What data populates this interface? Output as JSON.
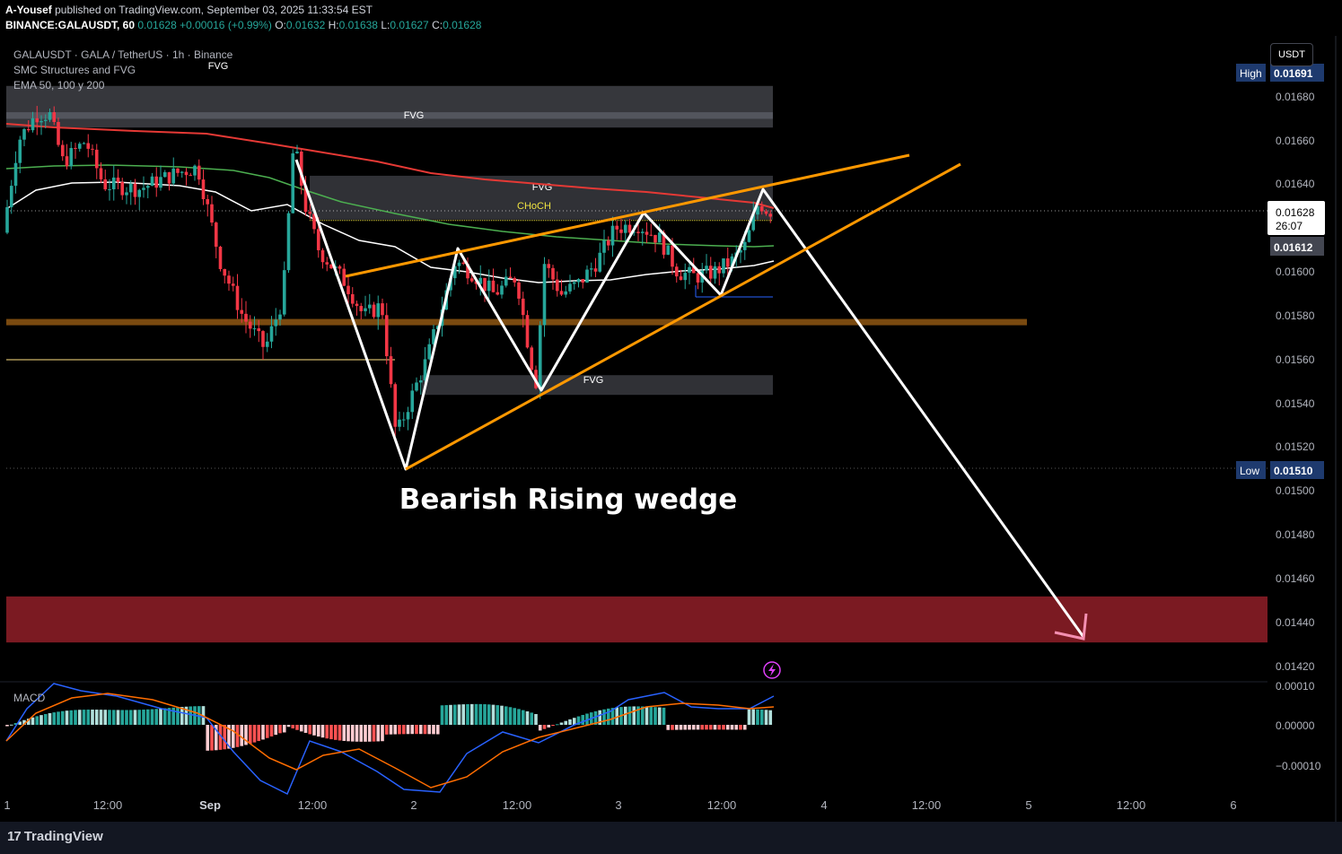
{
  "header": {
    "author": "A-Yousef",
    "published_text": "published on TradingView.com, September 03, 2025 11:33:54 EST",
    "symbol_line": "BINANCE:GALAUSDT, 60",
    "last": "0.01628",
    "change": "+0.00016 (+0.99%)",
    "o_label": "O:",
    "o": "0.01632",
    "h_label": "H:",
    "h": "0.01638",
    "l_label": "L:",
    "l": "0.01627",
    "c_label": "C:",
    "c": "0.01628"
  },
  "legend": {
    "title": "GALAUSDT · GALA / TetherUS · 1h · Binance",
    "indicator1": "SMC Structures and FVG",
    "indicator2": "EMA 50, 100 y 200",
    "macd_label": "MACD"
  },
  "currency": "USDT",
  "footer": {
    "brand": "TradingView",
    "brand_mark": "17"
  },
  "colors": {
    "up": "#26a69a",
    "down": "#f23645",
    "wedge": "#ff9800",
    "sr_line": "#7a4a10",
    "target_zone": "#7b1a22",
    "ema50": "#4caf50",
    "ema100": "#ffffff",
    "ema200": "#e53935",
    "macd": "#2962ff",
    "signal": "#ff6d00"
  },
  "chart_data": {
    "type": "candlestick",
    "annotation": "Bearish Rising wedge",
    "fvg_labels": [
      "FVG",
      "FVG",
      "FVG",
      "FVG"
    ],
    "choch_label": "CHoCH",
    "price_axis": {
      "ylim": [
        0.0141,
        0.01695
      ],
      "ticks": [
        "0.01680",
        "0.01660",
        "0.01640",
        "0.01620",
        "0.01600",
        "0.01580",
        "0.01560",
        "0.01540",
        "0.01520",
        "0.01500",
        "0.01480",
        "0.01460",
        "0.01440",
        "0.01420"
      ]
    },
    "badges": {
      "high_label": "High",
      "high": "0.01691",
      "low_label": "Low",
      "low": "0.01510",
      "current": "0.01628",
      "countdown": "26:07",
      "ema": "0.01612"
    },
    "time_axis": {
      "labels": [
        "1",
        "12:00",
        "Sep",
        "12:00",
        "2",
        "12:00",
        "3",
        "12:00",
        "4",
        "12:00",
        "5",
        "12:00",
        "6"
      ]
    },
    "macd_axis": {
      "ticks": [
        "0.00010",
        "0.00000",
        "−0.00010"
      ]
    },
    "candles_ohlc_start": "Sep 1 ~05:00",
    "zones": {
      "fvg_top": [
        0.0167,
        0.01685
      ],
      "fvg_upper": [
        0.01666,
        0.01673
      ],
      "fvg_mid": [
        0.01624,
        0.01644
      ],
      "fvg_low": [
        0.01544,
        0.01553
      ],
      "support_line": 0.01577,
      "target_zone": [
        0.01431,
        0.01452
      ],
      "choch_level": 0.01624
    },
    "wedge": {
      "upper": [
        [
          385,
          0.01598
        ],
        [
          1013,
          0.01654
        ]
      ],
      "lower": [
        [
          452,
          0.0151
        ],
        [
          1070,
          0.01649
        ]
      ]
    },
    "zigzag": [
      [
        330,
        0.01654
      ],
      [
        452,
        0.0151
      ],
      [
        510,
        0.01612
      ],
      [
        603,
        0.01545
      ],
      [
        717,
        0.01624
      ],
      [
        803,
        0.01589
      ],
      [
        850,
        0.01638
      ],
      [
        1207,
        0.01433
      ]
    ]
  }
}
